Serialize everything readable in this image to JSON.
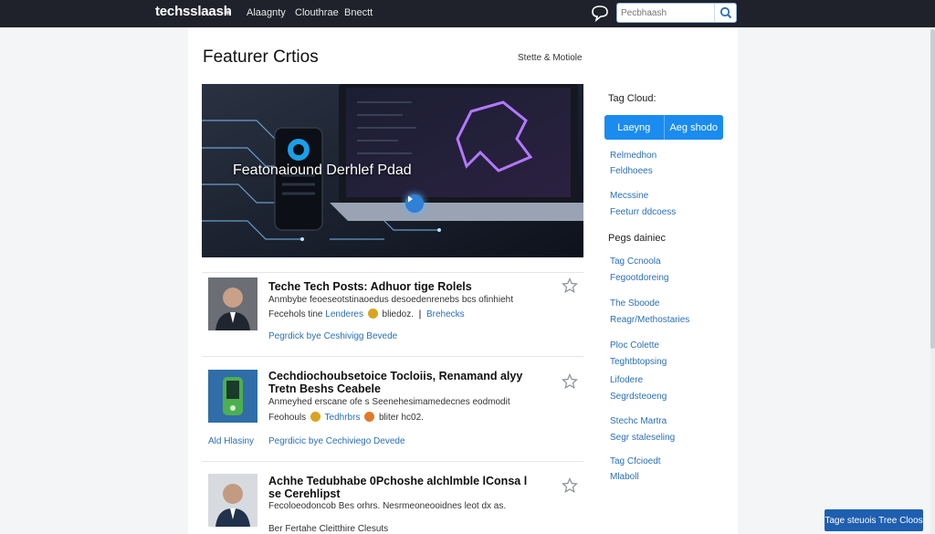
{
  "nav": {
    "brand": "techsslaash",
    "links": [
      "Alaagnty",
      "Clouthrae",
      "Bnectt"
    ],
    "search_placeholder": "Pecbhaash"
  },
  "main": {
    "title": "Featurer Crtios",
    "sort_label": "Stette & Motiole",
    "hero_caption": "Featonaiound Derhlef Pdad"
  },
  "posts": [
    {
      "title": "Teche Tech Posts: Adhuor tige Rolels",
      "excerpt": "Anmbybe feoeseotstinaoedus desoedenrenebs bcs ofinhieht",
      "meta_a": "Fecehols tine",
      "meta_link": "Lenderes",
      "meta_b": "bliedoz.",
      "meta_link2": "Brehecks",
      "tags": "Pegrdick bye Ceshivigg Bevede"
    },
    {
      "title": "Cechdiochoubsetoice Tocloiis, Renamand alyy Tretn Beshs Ceabele",
      "excerpt": "Anmeyhed erscane ofe s Seenehesimamedecnes eodmodit",
      "meta_a": "Feohouls",
      "meta_link": "Tedhrbrs",
      "meta_b": "bliter hc02.",
      "author": "Ald Hlasiny",
      "tags": "Pegrdicic bye Cechiviego Devede"
    },
    {
      "title": "Achhe Tedubhabe 0Pchoshe alchlmble lConsa l se Cerehlipst",
      "excerpt": "Fecoloeodoncob Bes orhrs. Nesrmeoneooidnes leot dx as.",
      "tags": "Ber Fertahe Cleitthire Clesuts"
    }
  ],
  "sidebar": {
    "tag_cloud_heading": "Tag Cloud:",
    "tag_buttons": [
      "Laeyng",
      "Aeg shodo"
    ],
    "group1": [
      "Relmedhon",
      "Feldhoees"
    ],
    "group2": [
      "Mecssine",
      "Feeturr ddcoess"
    ],
    "pages_heading": "Pegs dainiec",
    "group3": [
      "Tag Ccnoola",
      "Fegootdoreing"
    ],
    "group4": [
      "The Sboode",
      "Reagr/Methostaries"
    ],
    "group5": [
      "Ploc Colette",
      "Teghtbtopsing"
    ],
    "group6": [
      "Lifodere",
      "Segrdsteoeng"
    ],
    "group7": [
      "Stechc Martra",
      "Segr staleseling"
    ],
    "group8": [
      "Tag Cfcioedt",
      "Mlaboll"
    ]
  },
  "float_button": "Tage steuois Tree Cloos",
  "colors": {
    "topbar": "#1f222b",
    "accent": "#1a8cf0",
    "link": "#2a6fba"
  }
}
